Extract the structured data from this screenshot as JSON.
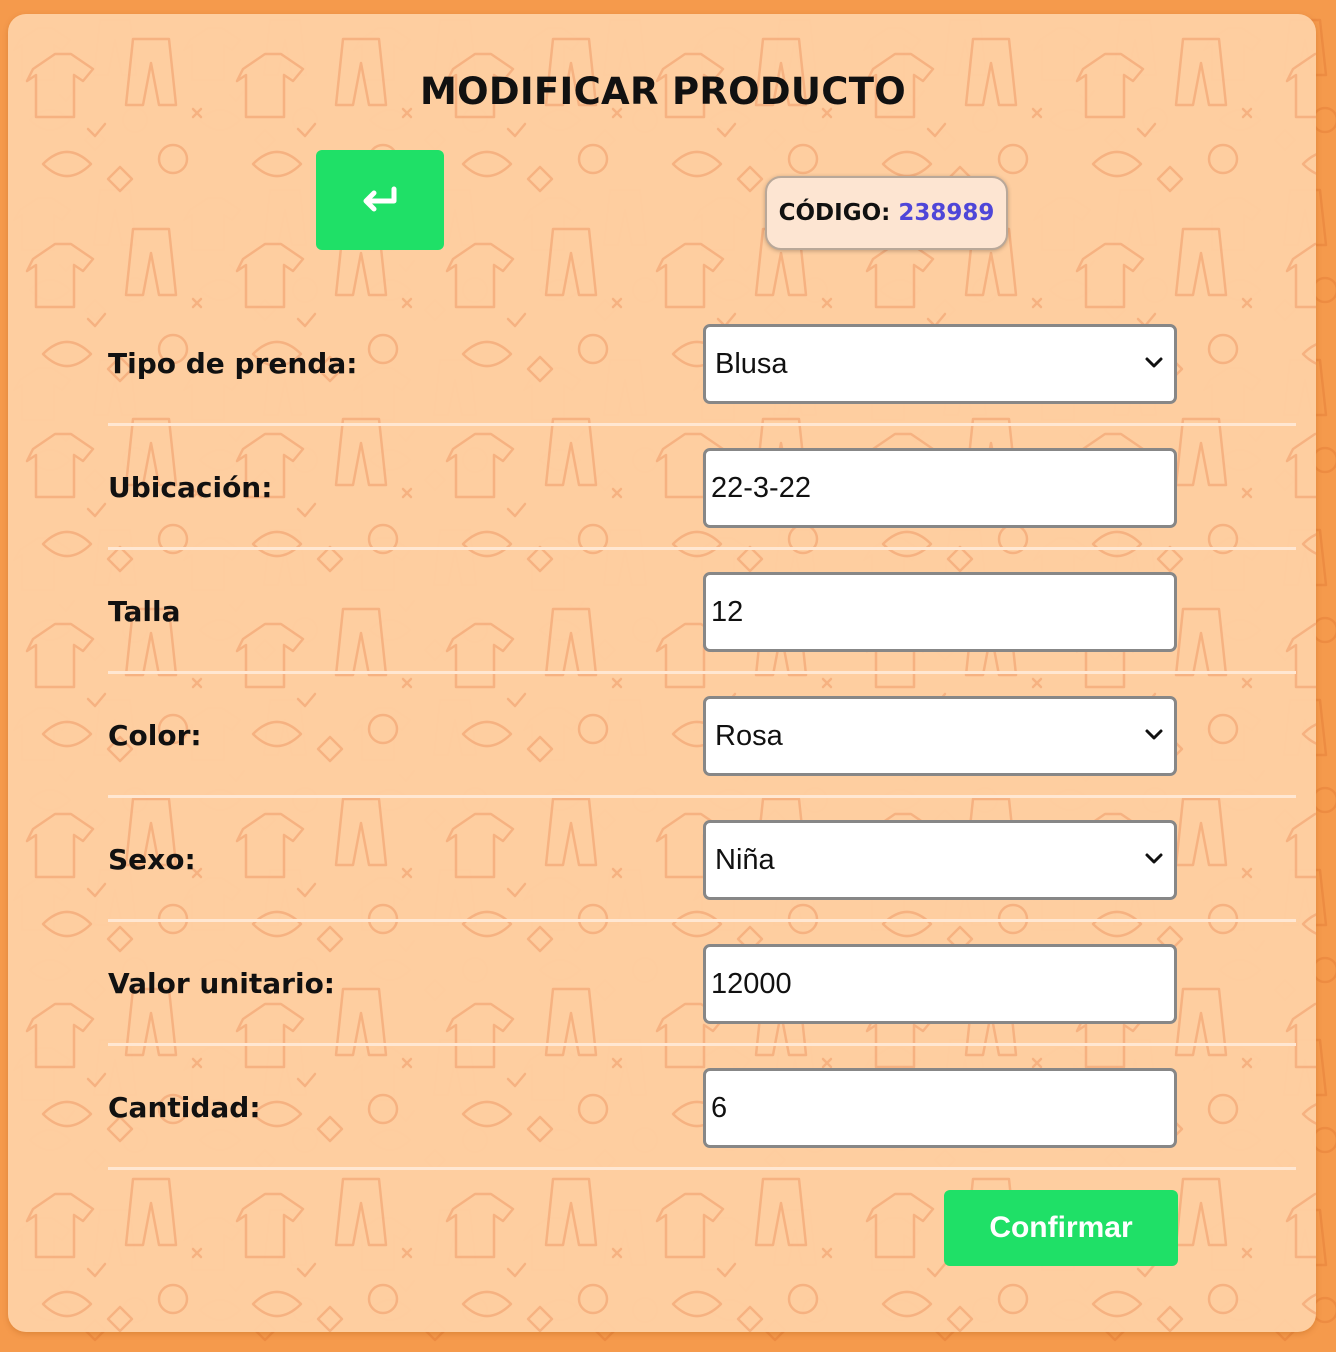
{
  "theme": {
    "page_background": "#f59a4c",
    "card_background": "#ffd4aa",
    "button_green": "#1fe067",
    "code_value_color": "#4f46d8",
    "pattern": "clothing-doodle-pattern"
  },
  "header": {
    "title": "MODIFICAR PRODUCTO",
    "back_icon": "return-arrow-icon"
  },
  "code": {
    "label": "CÓDIGO:",
    "value": "238989"
  },
  "form": {
    "rows": [
      {
        "label": "Tipo de prenda:",
        "type": "select",
        "value": "Blusa"
      },
      {
        "label": "Ubicación:",
        "type": "input",
        "value": "22-3-22"
      },
      {
        "label": "Talla",
        "type": "input",
        "value": "12"
      },
      {
        "label": "Color:",
        "type": "select",
        "value": "Rosa"
      },
      {
        "label": "Sexo:",
        "type": "select",
        "value": "Niña"
      },
      {
        "label": "Valor unitario:",
        "type": "input",
        "value": "12000"
      },
      {
        "label": "Cantidad:",
        "type": "input",
        "value": "6"
      }
    ]
  },
  "actions": {
    "confirm_label": "Confirmar"
  }
}
